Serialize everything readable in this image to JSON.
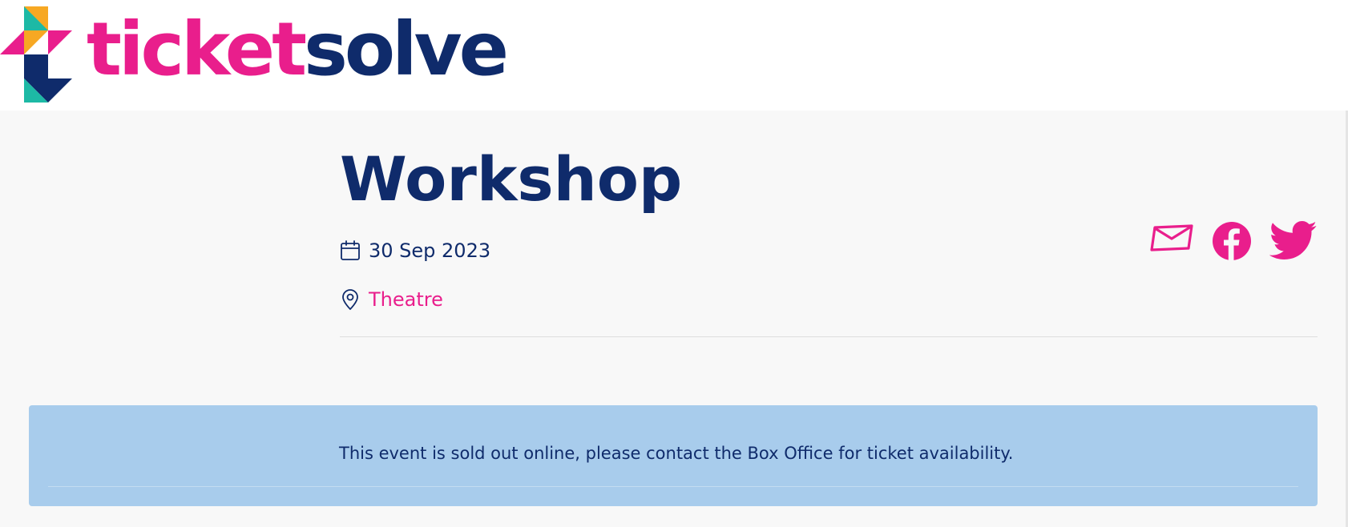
{
  "brand": {
    "name_part1": "ticket",
    "name_part2": "solve",
    "colors": {
      "pink": "#e91e8c",
      "navy": "#0f2b6b",
      "orange": "#f7a823",
      "teal": "#1db9a5"
    },
    "icon": "ticketsolve-logo-mark"
  },
  "event": {
    "title": "Workshop",
    "date": "30 Sep 2023",
    "venue": "Theatre"
  },
  "icons": {
    "date": "calendar-icon",
    "venue": "location-pin-icon",
    "share": [
      "email-icon",
      "facebook-icon",
      "twitter-icon"
    ]
  },
  "alert": {
    "message": "This event is sold out online, please contact the Box Office for ticket availability.",
    "background": "#a8ccec"
  }
}
